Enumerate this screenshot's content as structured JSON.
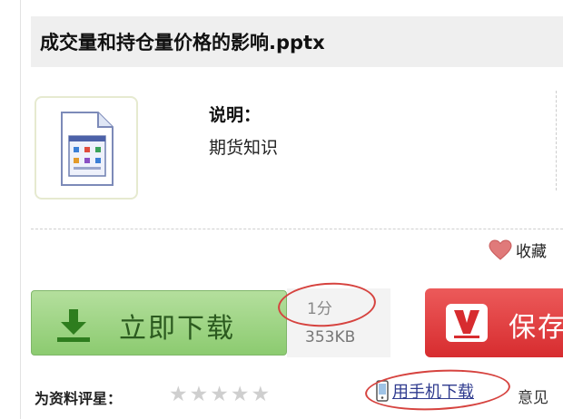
{
  "document": {
    "title": "成交量和持仓量价格的影响.pptx",
    "description_label": "说明：",
    "description_value": "期货知识",
    "file_icon": "pptx-file-icon"
  },
  "actions": {
    "favorite_label": "收藏",
    "favorite_icon": "heart-icon",
    "download_label": "立即下载",
    "download_icon": "download-arrow-icon",
    "points": "1分",
    "file_size": "353KB",
    "save_label": "保存",
    "save_icon": "v-logo-icon"
  },
  "footer": {
    "rate_label": "为资料评星：",
    "stars_total": 5,
    "stars_filled": 0,
    "mobile_download_label": "用手机下载",
    "mobile_icon": "phone-icon",
    "feedback_partial": "意见"
  },
  "colors": {
    "download_green": "#8ccb70",
    "save_red": "#d72c2f",
    "annotation_red": "#d6433f",
    "link_blue": "#2f3b8f"
  }
}
